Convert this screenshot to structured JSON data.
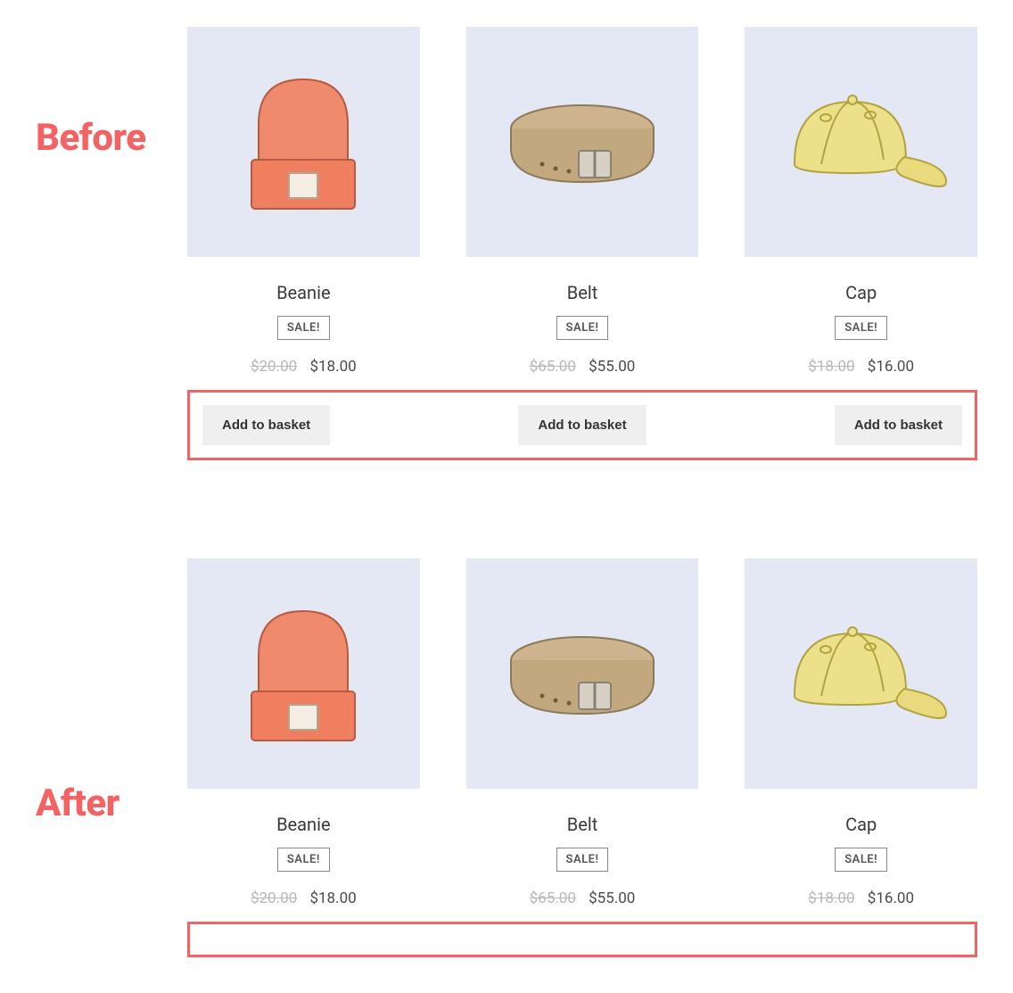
{
  "labels": {
    "before": "Before",
    "after": "After"
  },
  "sale_badge": "SALE!",
  "add_button": "Add to basket",
  "products": [
    {
      "name": "Beanie",
      "old_price": "$20.00",
      "new_price": "$18.00"
    },
    {
      "name": "Belt",
      "old_price": "$65.00",
      "new_price": "$55.00"
    },
    {
      "name": "Cap",
      "old_price": "$18.00",
      "new_price": "$16.00"
    }
  ]
}
